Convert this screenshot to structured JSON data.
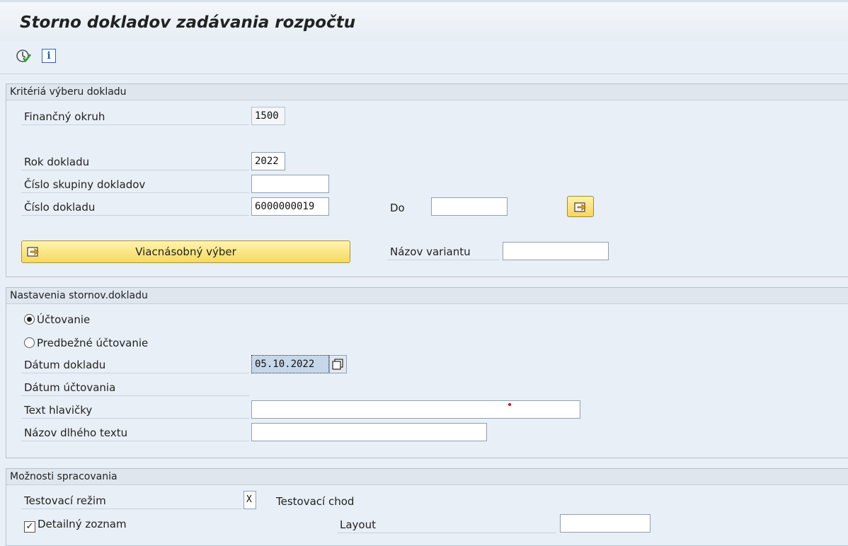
{
  "window": {
    "title": "Storno dokladov zadávania rozpočtu"
  },
  "toolbar": {
    "execute_icon": "execute-icon",
    "info_icon": "info-icon",
    "info_glyph": "i"
  },
  "criteria": {
    "title": "Kritériá výberu dokladu",
    "fin_area_label": "Finančný okruh",
    "fin_area_value": "1500",
    "year_label": "Rok dokladu",
    "year_value": "2022",
    "group_label": "Číslo skupiny dokladov",
    "group_value": "",
    "doc_no_label": "Číslo dokladu",
    "doc_no_value": "6000000019",
    "to_label": "Do",
    "to_value": "",
    "multi_select_label": "Viacnásobný výber",
    "variant_label": "Názov variantu",
    "variant_value": ""
  },
  "settings": {
    "title": "Nastavenia stornov.dokladu",
    "radio_posting": "Účtovanie",
    "radio_preliminary": "Predbežné účtovanie",
    "doc_date_label": "Dátum dokladu",
    "doc_date_value": "05.10.2022",
    "posting_date_label": "Dátum účtovania",
    "header_text_label": "Text hlavičky",
    "header_text_value": "",
    "long_text_label": "Názov dlhého textu",
    "long_text_value": ""
  },
  "processing": {
    "title": "Možnosti spracovania",
    "test_mode_label": "Testovací režim",
    "test_mode_value": "X",
    "test_run_label": "Testovací chod",
    "detail_list_label": "Detailný zoznam",
    "detail_list_checked": true,
    "check_glyph": "✓",
    "layout_label": "Layout",
    "layout_value": ""
  }
}
